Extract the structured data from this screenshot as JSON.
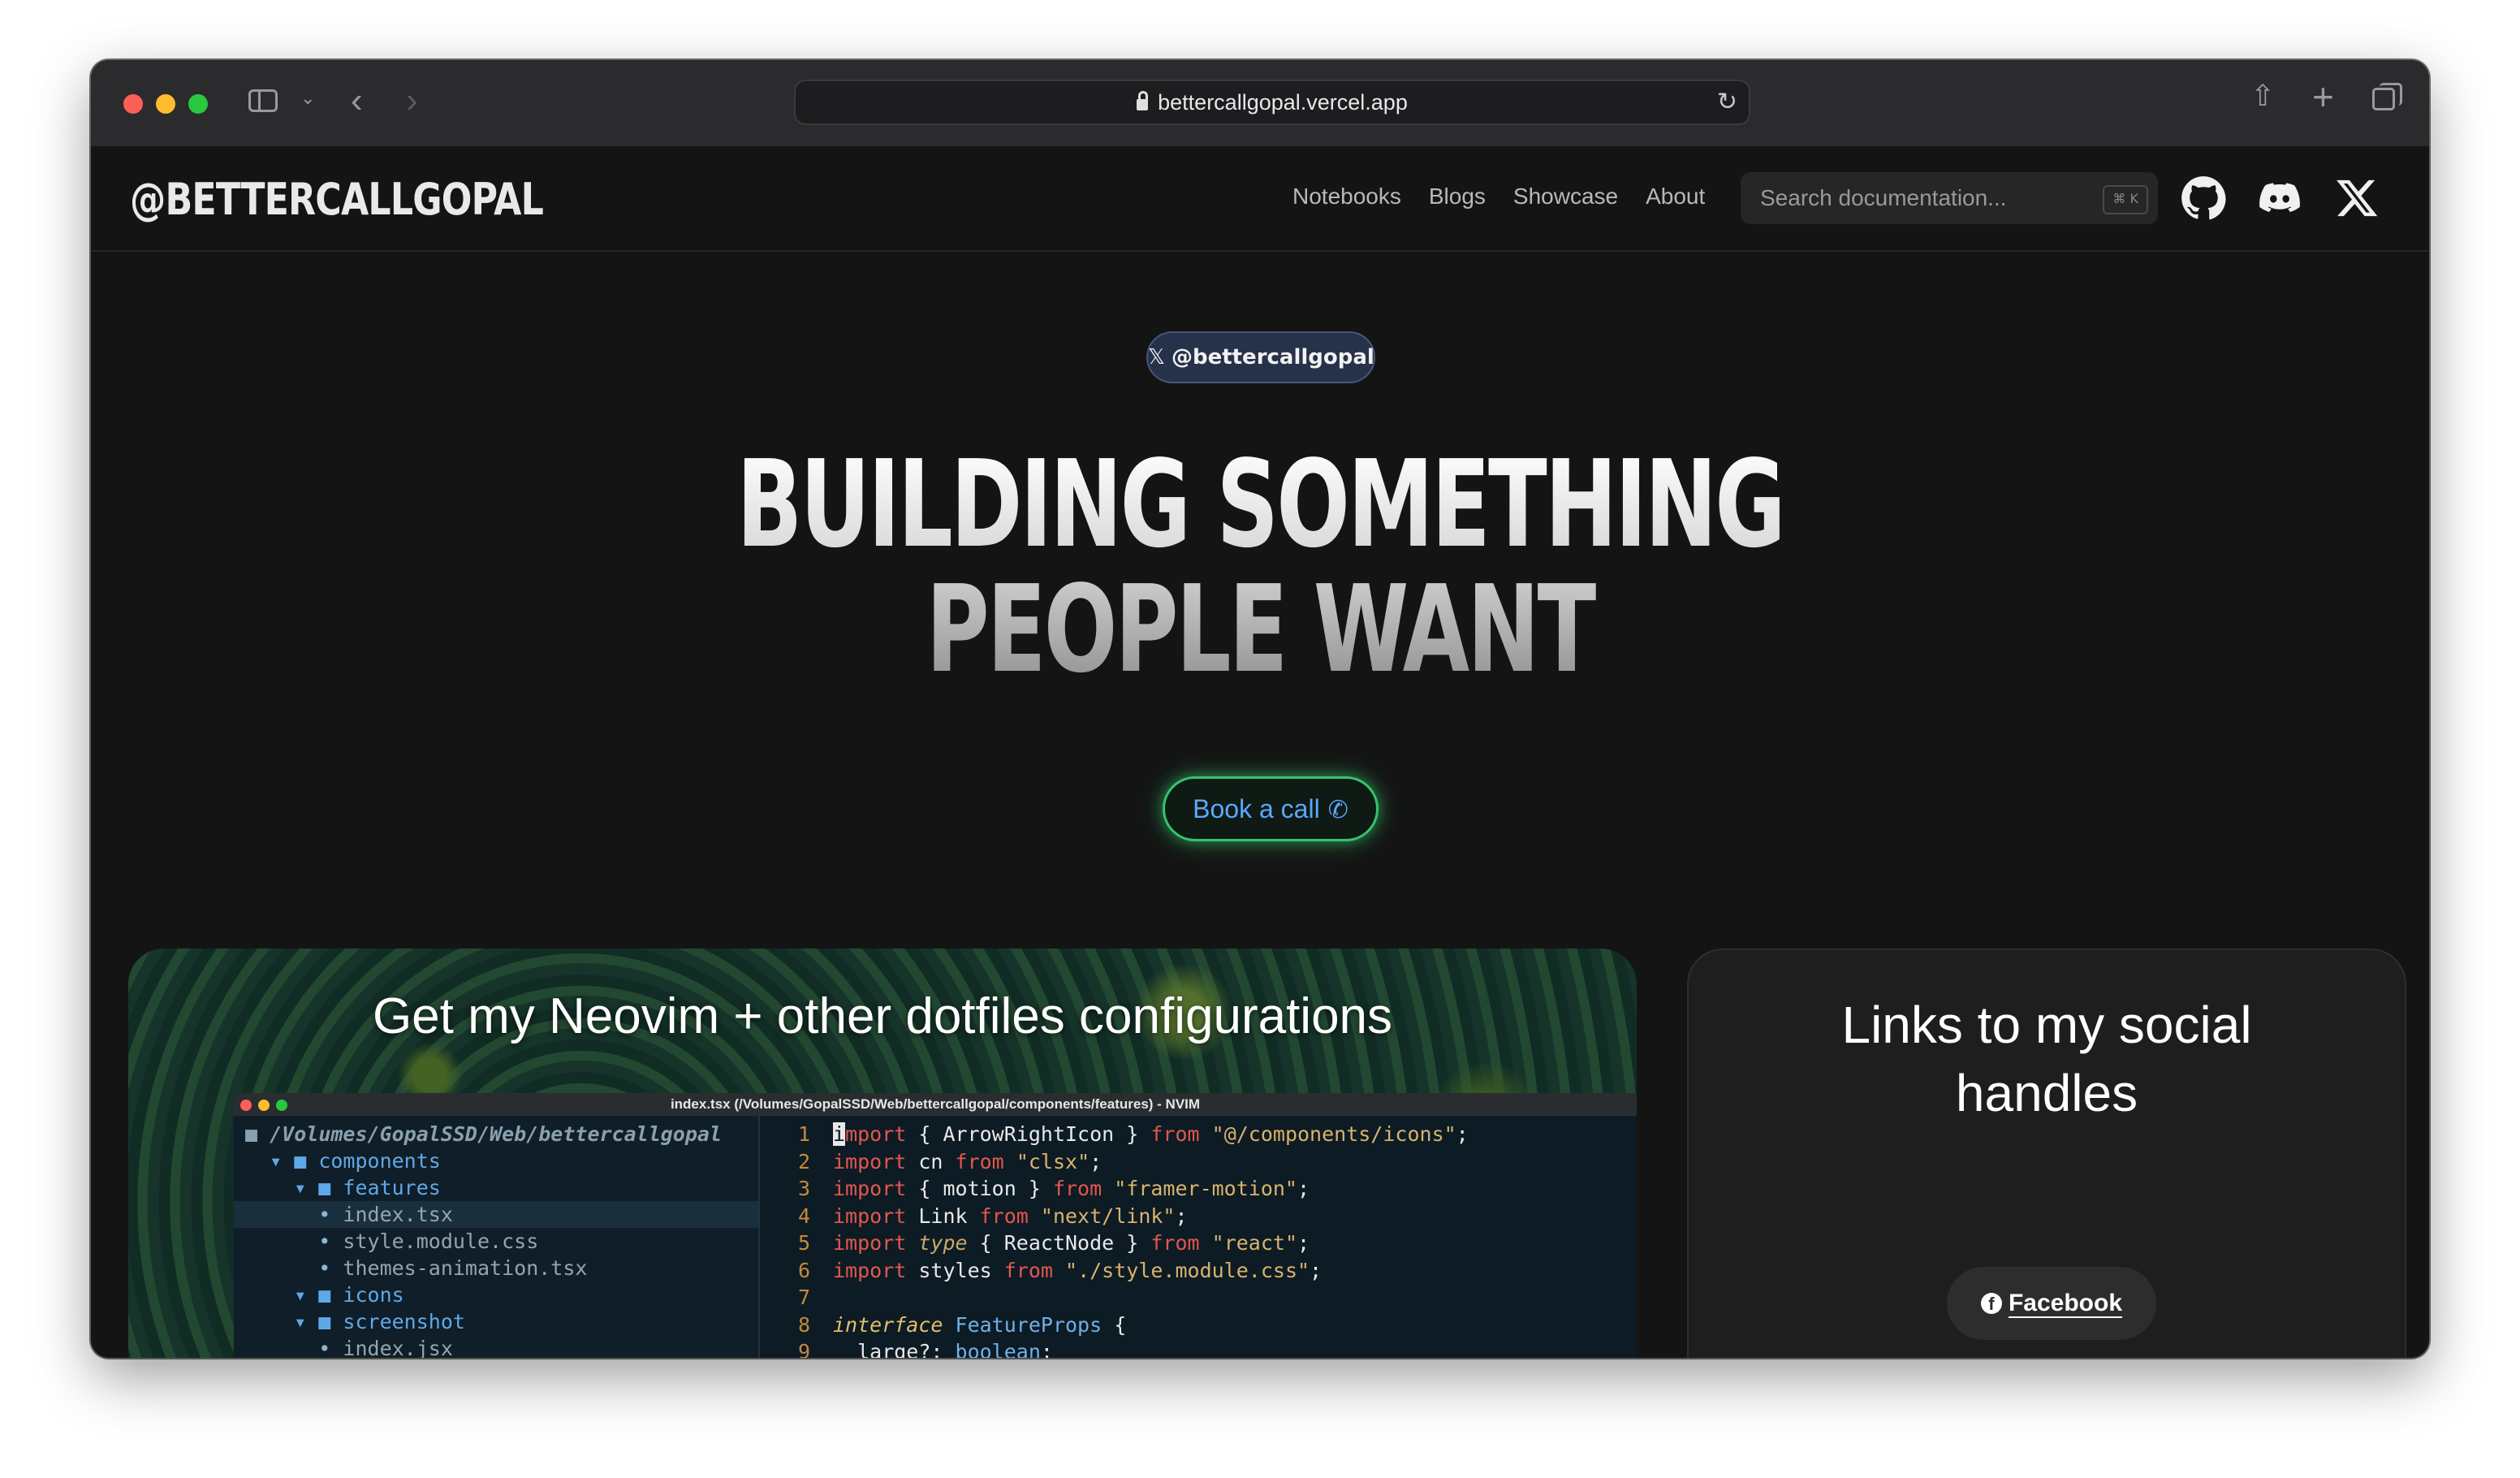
{
  "browser": {
    "url": "bettercallgopal.vercel.app"
  },
  "site": {
    "logo": "@BETTERCALLGOPAL",
    "nav": [
      "Notebooks",
      "Blogs",
      "Showcase",
      "About"
    ],
    "search": {
      "placeholder": "Search documentation...",
      "shortcut": "⌘ K"
    }
  },
  "hero": {
    "badge": "@bettercallgopal",
    "title_line1": "BUILDING SOMETHING",
    "title_line2": "PEOPLE WANT",
    "cta": "Book a call"
  },
  "cards": {
    "dotfiles": {
      "title": "Get my Neovim + other dotfiles configurations",
      "terminal_title": "index.tsx (/Volumes/GopalSSD/Web/bettercallgopal/components/features) - NVIM",
      "tree": [
        {
          "text": "/Volumes/GopalSSD/Web/bettercallgopal",
          "kind": "root"
        },
        {
          "text": "components",
          "kind": "dir",
          "indent": 1
        },
        {
          "text": "features",
          "kind": "dir",
          "indent": 2
        },
        {
          "text": "index.tsx",
          "kind": "file",
          "indent": 3,
          "selected": true
        },
        {
          "text": "style.module.css",
          "kind": "file",
          "indent": 3
        },
        {
          "text": "themes-animation.tsx",
          "kind": "file",
          "indent": 3
        },
        {
          "text": "icons",
          "kind": "dir",
          "indent": 2
        },
        {
          "text": "screenshot",
          "kind": "dir",
          "indent": 2
        },
        {
          "text": "index.jsx",
          "kind": "file",
          "indent": 3
        }
      ],
      "code": [
        {
          "n": "1",
          "line": "import { ArrowRightIcon } from \"@/components/icons\";"
        },
        {
          "n": "2",
          "line": "import cn from \"clsx\";"
        },
        {
          "n": "3",
          "line": "import { motion } from \"framer-motion\";"
        },
        {
          "n": "4",
          "line": "import Link from \"next/link\";"
        },
        {
          "n": "5",
          "line": "import type { ReactNode } from \"react\";"
        },
        {
          "n": "6",
          "line": "import styles from \"./style.module.css\";"
        },
        {
          "n": "7",
          "line": ""
        },
        {
          "n": "8",
          "line": "interface FeatureProps {"
        },
        {
          "n": "9",
          "line": "  large?: boolean;"
        }
      ]
    },
    "social": {
      "title": "Links to my social handles",
      "facebook": "Facebook"
    }
  },
  "colors": {
    "cta_border": "#35c46a",
    "cta_text": "#5aa8ff",
    "badge_bg": "#25324a"
  }
}
